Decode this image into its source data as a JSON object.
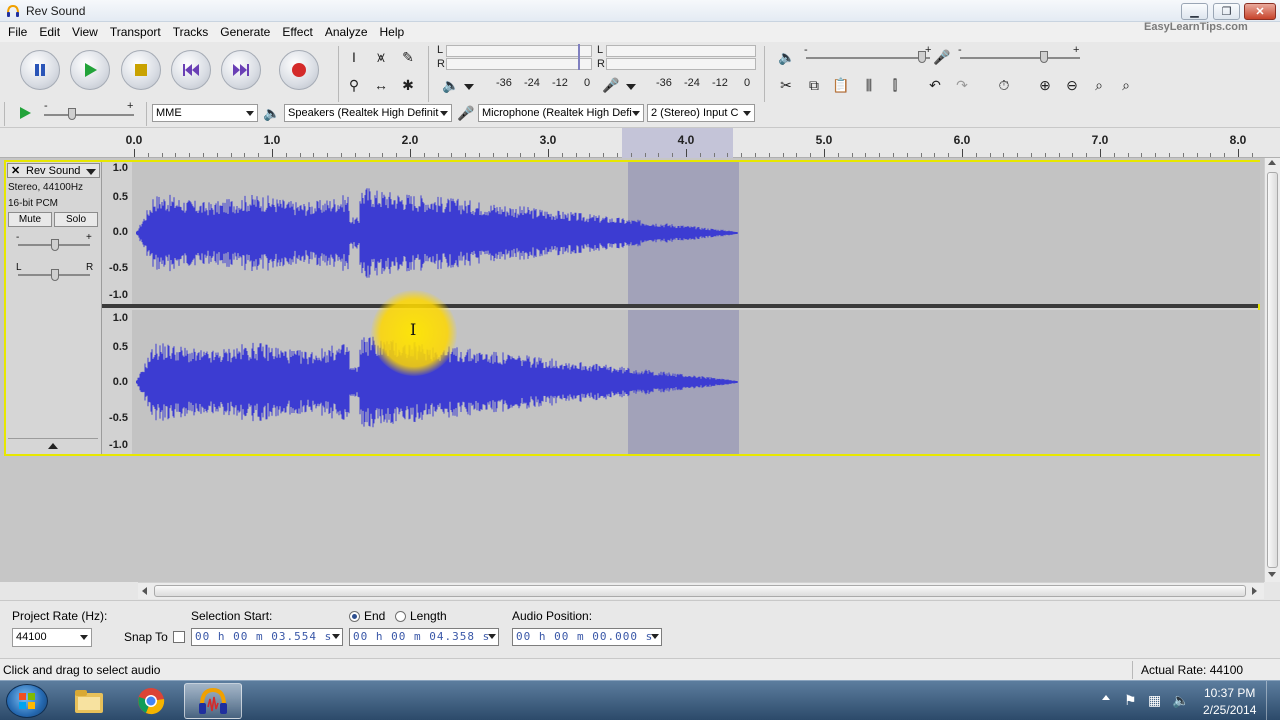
{
  "window": {
    "title": "Rev Sound",
    "watermark": "EasyLearnTips.com",
    "buttons": [
      "minimize",
      "maximize",
      "close"
    ]
  },
  "menu": [
    "File",
    "Edit",
    "View",
    "Transport",
    "Tracks",
    "Generate",
    "Effect",
    "Analyze",
    "Help"
  ],
  "transport_buttons": [
    "pause",
    "play",
    "stop",
    "skip-to-start",
    "skip-to-end",
    "record"
  ],
  "meters": {
    "playback_channels": [
      "L",
      "R"
    ],
    "record_channels": [
      "L",
      "R"
    ],
    "playback_scale": [
      "-36",
      "-24",
      "-12",
      "0"
    ],
    "record_scale": [
      "-36",
      "-24",
      "-12",
      "0"
    ]
  },
  "mixer": {
    "minus": "-",
    "plus": "+"
  },
  "device": {
    "host": "MME",
    "playback_device": "Speakers (Realtek High Definit",
    "recording_device": "Microphone (Realtek High Defi",
    "channels": "2 (Stereo) Input C"
  },
  "ruler": {
    "labels": [
      "0.0",
      "1.0",
      "2.0",
      "3.0",
      "4.0",
      "5.0",
      "6.0",
      "7.0",
      "8.0"
    ]
  },
  "track": {
    "name": "Rev Sound",
    "info_line1": "Stereo, 44100Hz",
    "info_line2": "16-bit PCM",
    "mute_label": "Mute",
    "solo_label": "Solo",
    "gain_minus": "-",
    "gain_plus": "+",
    "pan_left": "L",
    "pan_right": "R",
    "scale_labels": [
      "1.0",
      "0.5",
      "0.0",
      "-0.5",
      "-1.0"
    ],
    "selection_start_sec": 3.554,
    "selection_end_sec": 4.358,
    "audio_length_sec": 4.36
  },
  "selection_bar": {
    "project_rate_label": "Project Rate (Hz):",
    "project_rate_value": "44100",
    "snap_to_label": "Snap To",
    "selection_start_label": "Selection Start:",
    "end_label": "End",
    "length_label": "Length",
    "audio_position_label": "Audio Position:",
    "selection_start_value": "00 h 00 m 03.554 s",
    "selection_end_value": "00 h 00 m 04.358 s",
    "audio_position_value": "00 h 00 m 00.000 s"
  },
  "status": {
    "message": "Click and drag to select audio",
    "actual_rate": "Actual Rate: 44100"
  },
  "taskbar": {
    "clock_time": "10:37 PM",
    "clock_date": "2/25/2014"
  },
  "colors": {
    "waveform": "#3c3cd2",
    "selection": "#a2a2b9",
    "track_focus": "#e7e700",
    "highlight": "#ffd700"
  }
}
